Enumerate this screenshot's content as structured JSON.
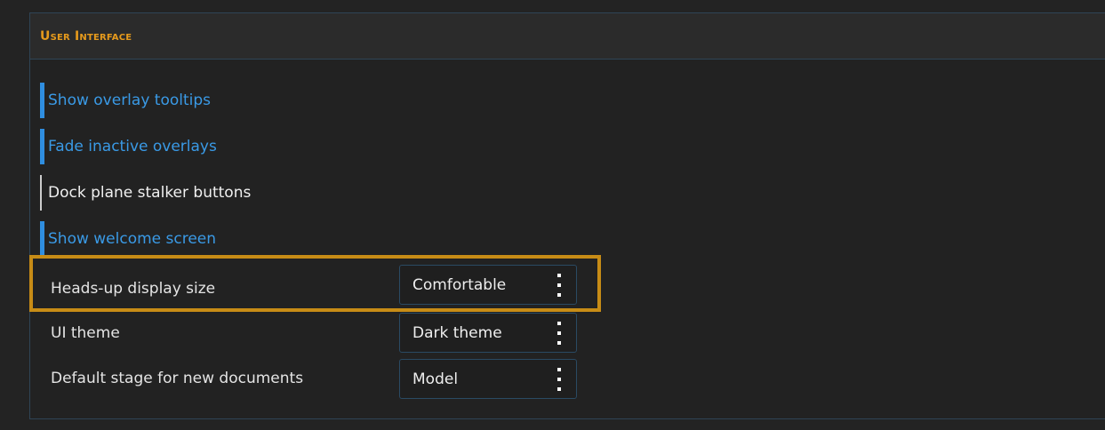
{
  "panel": {
    "title": "User Interface"
  },
  "toggles": [
    {
      "label": "Show overlay tooltips",
      "enabled": true
    },
    {
      "label": "Fade inactive overlays",
      "enabled": true
    },
    {
      "label": "Dock plane stalker buttons",
      "enabled": false
    },
    {
      "label": "Show welcome screen",
      "enabled": true
    }
  ],
  "settings": [
    {
      "label": "Heads-up display size",
      "value": "Comfortable",
      "highlighted": true
    },
    {
      "label": "UI theme",
      "value": "Dark theme",
      "highlighted": false
    },
    {
      "label": "Default stage for new documents",
      "value": "Model",
      "highlighted": false
    }
  ],
  "colors": {
    "accent": "#2f8ee0",
    "header_text": "#e69a1c",
    "highlight_border": "#c78c16"
  }
}
